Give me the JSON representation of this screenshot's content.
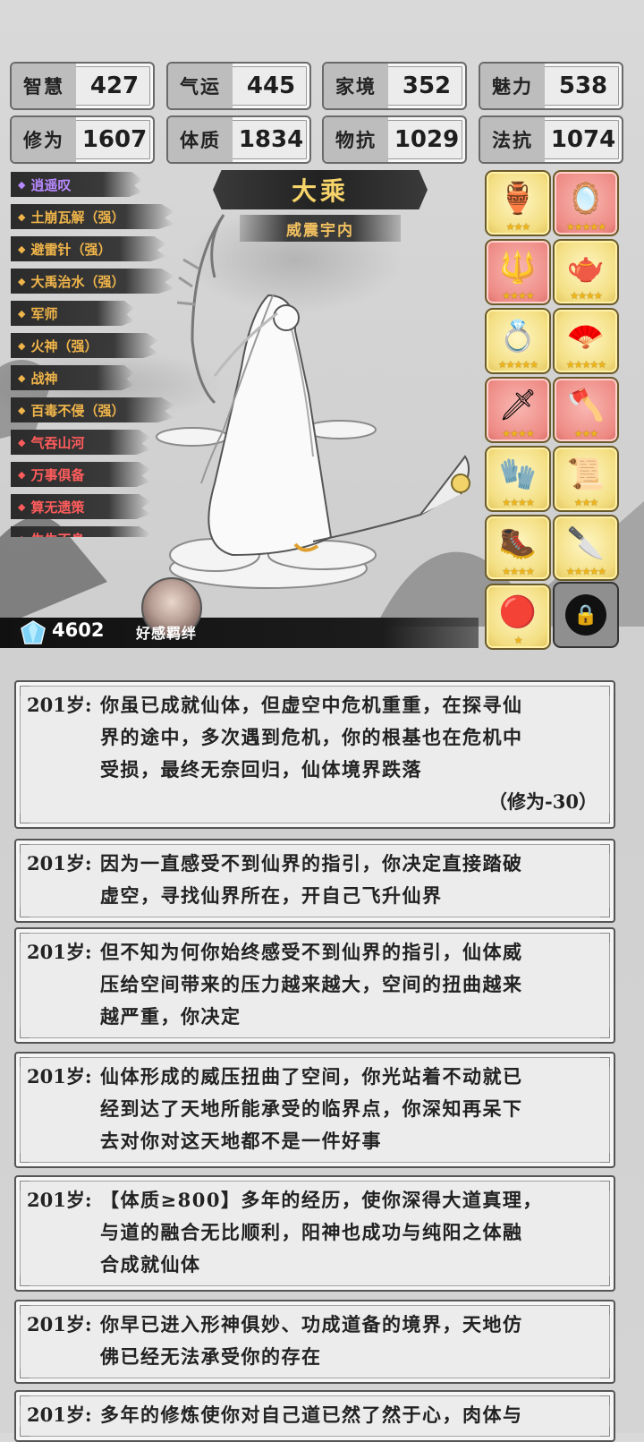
{
  "stats": [
    {
      "label": "智慧",
      "value": "427"
    },
    {
      "label": "气运",
      "value": "445"
    },
    {
      "label": "家境",
      "value": "352"
    },
    {
      "label": "魅力",
      "value": "538"
    },
    {
      "label": "修为",
      "value": "1607"
    },
    {
      "label": "体质",
      "value": "1834"
    },
    {
      "label": "物抗",
      "value": "1029"
    },
    {
      "label": "法抗",
      "value": "1074"
    }
  ],
  "rank": {
    "title": "大乘",
    "subtitle": "威震宇内"
  },
  "skills": [
    {
      "label": "逍遥叹",
      "color": "#b889ff"
    },
    {
      "label": "土崩瓦解（强）",
      "color": "#f0b54a"
    },
    {
      "label": "避雷针（强）",
      "color": "#f0b54a"
    },
    {
      "label": "大禹治水（强）",
      "color": "#f0b54a"
    },
    {
      "label": "军师",
      "color": "#f0b54a"
    },
    {
      "label": "火神（强）",
      "color": "#f0b54a"
    },
    {
      "label": "战神",
      "color": "#f0b54a"
    },
    {
      "label": "百毒不侵（强）",
      "color": "#f0b54a"
    },
    {
      "label": "气吞山河",
      "color": "#ff5c5c"
    },
    {
      "label": "万事俱备",
      "color": "#ff5c5c"
    },
    {
      "label": "算无遗策",
      "color": "#ff5c5c"
    },
    {
      "label": "生生不息",
      "color": "#ff5c5c"
    }
  ],
  "items": [
    {
      "name": "cauldron-icon",
      "glyph": "🏺",
      "stars": "★★★",
      "rarity": "gold"
    },
    {
      "name": "mirror-icon",
      "glyph": "🪞",
      "stars": "★★★★★",
      "rarity": "red"
    },
    {
      "name": "halberd-icon",
      "glyph": "🔱",
      "stars": "★★★★",
      "rarity": "red"
    },
    {
      "name": "teapot-icon",
      "glyph": "🫖",
      "stars": "★★★★",
      "rarity": "gold"
    },
    {
      "name": "ring-icon",
      "glyph": "💍",
      "stars": "★★★★★",
      "rarity": "gold"
    },
    {
      "name": "fan-icon",
      "glyph": "🪭",
      "stars": "★★★★★",
      "rarity": "gold"
    },
    {
      "name": "sword-icon",
      "glyph": "🗡",
      "stars": "★★★★",
      "rarity": "red"
    },
    {
      "name": "axe-icon",
      "glyph": "🪓",
      "stars": "★★★",
      "rarity": "red"
    },
    {
      "name": "bracer-icon",
      "glyph": "🧤",
      "stars": "★★★★",
      "rarity": "gold"
    },
    {
      "name": "scroll-icon",
      "glyph": "📜",
      "stars": "★★★",
      "rarity": "gold"
    },
    {
      "name": "boot-icon",
      "glyph": "🥾",
      "stars": "★★★★",
      "rarity": "gold"
    },
    {
      "name": "dagger-icon",
      "glyph": "🔪",
      "stars": "★★★★★",
      "rarity": "gold"
    },
    {
      "name": "pearl-icon",
      "glyph": "🔴",
      "stars": "★",
      "rarity": "gold"
    }
  ],
  "resources": {
    "gems": "4602",
    "favor_label": "好感羁绊"
  },
  "events": [
    {
      "age": "201岁:",
      "lines": [
        "你虽已成就仙体，但虚空中危机重重，在探寻仙",
        "界的途中，多次遇到危机，你的根基也在危机中",
        "受损，最终无奈回归，仙体境界跌落"
      ],
      "delta": "（修为-30）"
    },
    {
      "age": "201岁:",
      "lines": [
        "因为一直感受不到仙界的指引，你决定直接踏破",
        "虚空，寻找仙界所在，开自己飞升仙界"
      ],
      "delta": ""
    },
    {
      "age": "201岁:",
      "lines": [
        "但不知为何你始终感受不到仙界的指引，仙体威",
        "压给空间带来的压力越来越大，空间的扭曲越来",
        "越严重，你决定"
      ],
      "delta": ""
    },
    {
      "age": "201岁:",
      "lines": [
        "仙体形成的威压扭曲了空间，你光站着不动就已",
        "经到达了天地所能承受的临界点，你深知再呆下",
        "去对你对这天地都不是一件好事"
      ],
      "delta": ""
    },
    {
      "age": "201岁:",
      "lines": [
        "【体质≥800】多年的经历，使你深得大道真理，",
        "与道的融合无比顺利，阳神也成功与纯阳之体融",
        "合成就仙体"
      ],
      "delta": ""
    },
    {
      "age": "201岁:",
      "lines": [
        "你早已进入形神俱妙、功成道备的境界，天地仿",
        "佛已经无法承受你的存在"
      ],
      "delta": ""
    },
    {
      "age": "201岁:",
      "lines": [
        "多年的修炼使你对自己道已然了然于心，肉体与"
      ],
      "delta": ""
    }
  ]
}
